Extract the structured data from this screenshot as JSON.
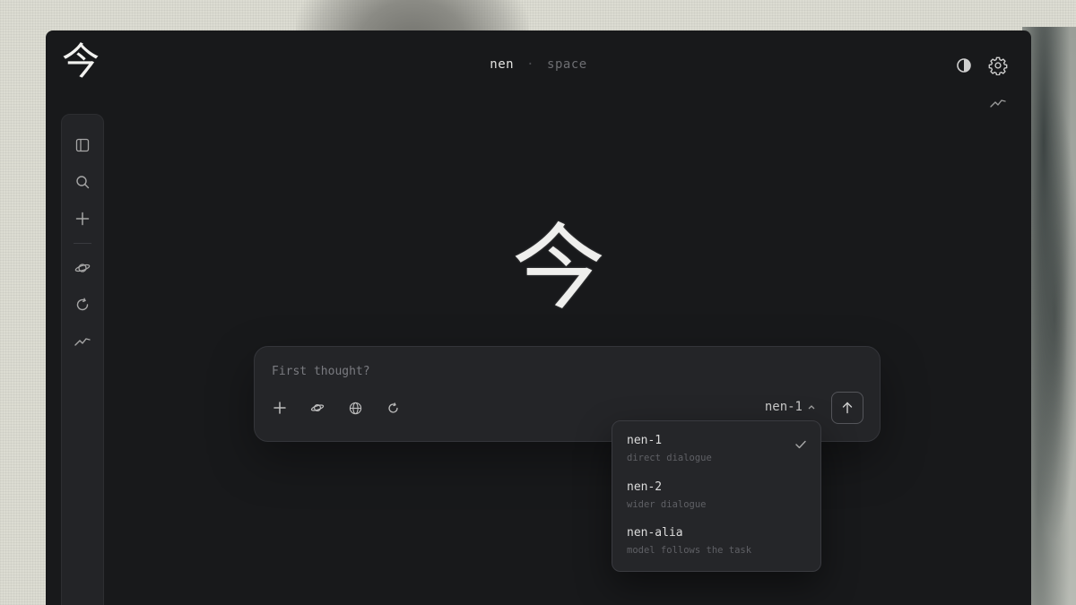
{
  "app": {
    "logo_glyph": "今",
    "hero_glyph": "今"
  },
  "tabs": {
    "active": "nen",
    "separator": "·",
    "inactive": "space"
  },
  "icons": {
    "contrast": "contrast-icon",
    "settings": "gear-icon",
    "trend": "trend-icon",
    "sidebar_toggle": "sidebar-toggle-icon",
    "search": "search-icon",
    "new": "plus-icon",
    "planet": "planet-icon",
    "refresh": "refresh-icon",
    "globe": "globe-icon",
    "send": "arrow-up-icon",
    "check": "check-icon"
  },
  "composer": {
    "placeholder": "First thought?",
    "selected_model": "nen-1"
  },
  "model_menu": {
    "items": [
      {
        "name": "nen-1",
        "desc": "direct dialogue",
        "selected": true
      },
      {
        "name": "nen-2",
        "desc": "wider dialogue",
        "selected": false
      },
      {
        "name": "nen-alia",
        "desc": "model follows the task",
        "selected": false
      }
    ]
  },
  "colors": {
    "window_bg": "#18191b",
    "panel_bg": "#242528",
    "text_primary": "#e4e4e2",
    "text_muted": "#6d6e72"
  }
}
